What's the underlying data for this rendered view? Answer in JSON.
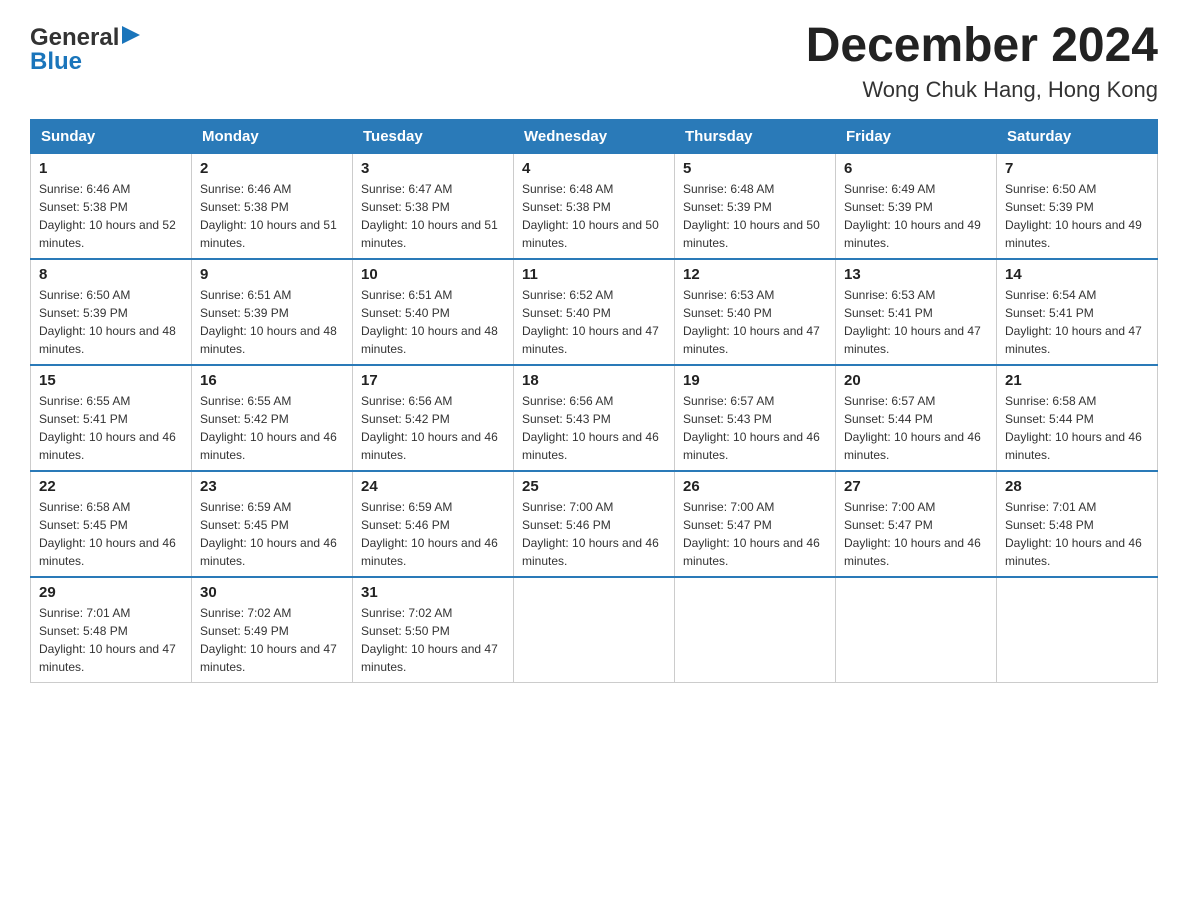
{
  "logo": {
    "text_general": "General",
    "text_blue": "Blue",
    "arrow_unicode": "▶"
  },
  "header": {
    "month": "December 2024",
    "location": "Wong Chuk Hang, Hong Kong"
  },
  "columns": [
    "Sunday",
    "Monday",
    "Tuesday",
    "Wednesday",
    "Thursday",
    "Friday",
    "Saturday"
  ],
  "weeks": [
    [
      {
        "day": "1",
        "sunrise": "6:46 AM",
        "sunset": "5:38 PM",
        "daylight": "10 hours and 52 minutes."
      },
      {
        "day": "2",
        "sunrise": "6:46 AM",
        "sunset": "5:38 PM",
        "daylight": "10 hours and 51 minutes."
      },
      {
        "day": "3",
        "sunrise": "6:47 AM",
        "sunset": "5:38 PM",
        "daylight": "10 hours and 51 minutes."
      },
      {
        "day": "4",
        "sunrise": "6:48 AM",
        "sunset": "5:38 PM",
        "daylight": "10 hours and 50 minutes."
      },
      {
        "day": "5",
        "sunrise": "6:48 AM",
        "sunset": "5:39 PM",
        "daylight": "10 hours and 50 minutes."
      },
      {
        "day": "6",
        "sunrise": "6:49 AM",
        "sunset": "5:39 PM",
        "daylight": "10 hours and 49 minutes."
      },
      {
        "day": "7",
        "sunrise": "6:50 AM",
        "sunset": "5:39 PM",
        "daylight": "10 hours and 49 minutes."
      }
    ],
    [
      {
        "day": "8",
        "sunrise": "6:50 AM",
        "sunset": "5:39 PM",
        "daylight": "10 hours and 48 minutes."
      },
      {
        "day": "9",
        "sunrise": "6:51 AM",
        "sunset": "5:39 PM",
        "daylight": "10 hours and 48 minutes."
      },
      {
        "day": "10",
        "sunrise": "6:51 AM",
        "sunset": "5:40 PM",
        "daylight": "10 hours and 48 minutes."
      },
      {
        "day": "11",
        "sunrise": "6:52 AM",
        "sunset": "5:40 PM",
        "daylight": "10 hours and 47 minutes."
      },
      {
        "day": "12",
        "sunrise": "6:53 AM",
        "sunset": "5:40 PM",
        "daylight": "10 hours and 47 minutes."
      },
      {
        "day": "13",
        "sunrise": "6:53 AM",
        "sunset": "5:41 PM",
        "daylight": "10 hours and 47 minutes."
      },
      {
        "day": "14",
        "sunrise": "6:54 AM",
        "sunset": "5:41 PM",
        "daylight": "10 hours and 47 minutes."
      }
    ],
    [
      {
        "day": "15",
        "sunrise": "6:55 AM",
        "sunset": "5:41 PM",
        "daylight": "10 hours and 46 minutes."
      },
      {
        "day": "16",
        "sunrise": "6:55 AM",
        "sunset": "5:42 PM",
        "daylight": "10 hours and 46 minutes."
      },
      {
        "day": "17",
        "sunrise": "6:56 AM",
        "sunset": "5:42 PM",
        "daylight": "10 hours and 46 minutes."
      },
      {
        "day": "18",
        "sunrise": "6:56 AM",
        "sunset": "5:43 PM",
        "daylight": "10 hours and 46 minutes."
      },
      {
        "day": "19",
        "sunrise": "6:57 AM",
        "sunset": "5:43 PM",
        "daylight": "10 hours and 46 minutes."
      },
      {
        "day": "20",
        "sunrise": "6:57 AM",
        "sunset": "5:44 PM",
        "daylight": "10 hours and 46 minutes."
      },
      {
        "day": "21",
        "sunrise": "6:58 AM",
        "sunset": "5:44 PM",
        "daylight": "10 hours and 46 minutes."
      }
    ],
    [
      {
        "day": "22",
        "sunrise": "6:58 AM",
        "sunset": "5:45 PM",
        "daylight": "10 hours and 46 minutes."
      },
      {
        "day": "23",
        "sunrise": "6:59 AM",
        "sunset": "5:45 PM",
        "daylight": "10 hours and 46 minutes."
      },
      {
        "day": "24",
        "sunrise": "6:59 AM",
        "sunset": "5:46 PM",
        "daylight": "10 hours and 46 minutes."
      },
      {
        "day": "25",
        "sunrise": "7:00 AM",
        "sunset": "5:46 PM",
        "daylight": "10 hours and 46 minutes."
      },
      {
        "day": "26",
        "sunrise": "7:00 AM",
        "sunset": "5:47 PM",
        "daylight": "10 hours and 46 minutes."
      },
      {
        "day": "27",
        "sunrise": "7:00 AM",
        "sunset": "5:47 PM",
        "daylight": "10 hours and 46 minutes."
      },
      {
        "day": "28",
        "sunrise": "7:01 AM",
        "sunset": "5:48 PM",
        "daylight": "10 hours and 46 minutes."
      }
    ],
    [
      {
        "day": "29",
        "sunrise": "7:01 AM",
        "sunset": "5:48 PM",
        "daylight": "10 hours and 47 minutes."
      },
      {
        "day": "30",
        "sunrise": "7:02 AM",
        "sunset": "5:49 PM",
        "daylight": "10 hours and 47 minutes."
      },
      {
        "day": "31",
        "sunrise": "7:02 AM",
        "sunset": "5:50 PM",
        "daylight": "10 hours and 47 minutes."
      },
      null,
      null,
      null,
      null
    ]
  ],
  "labels": {
    "sunrise_prefix": "Sunrise: ",
    "sunset_prefix": "Sunset: ",
    "daylight_prefix": "Daylight: "
  }
}
